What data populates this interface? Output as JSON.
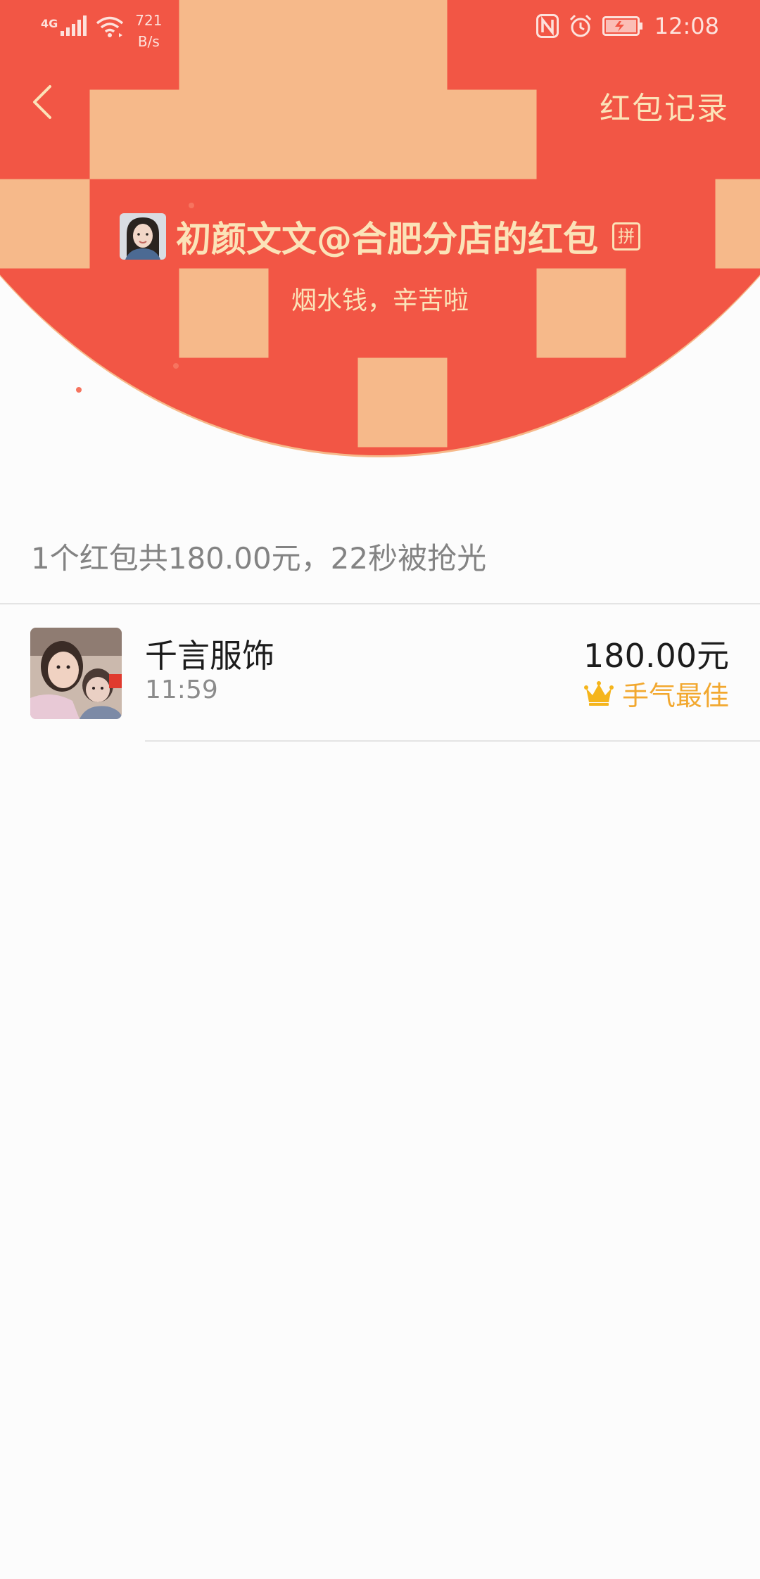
{
  "status_bar": {
    "network": "4G",
    "speed_value": "721",
    "speed_unit": "B/s",
    "time": "12:08",
    "icons": [
      "signal-icon",
      "wifi-icon",
      "nfc-icon",
      "alarm-icon",
      "battery-charging-icon"
    ]
  },
  "nav": {
    "back_icon": "back-arrow-icon",
    "records_label": "红包记录"
  },
  "packet": {
    "sender_title": "初颜文文@合肥分店的红包",
    "badge": "拼",
    "blessing": "烟水钱，辛苦啦"
  },
  "summary": {
    "text": "1个红包共180.00元，22秒被抢光"
  },
  "records": [
    {
      "name": "千言服饰",
      "time": "11:59",
      "amount": "180.00元",
      "best_label": "手气最佳",
      "best_icon": "crown-icon"
    }
  ],
  "colors": {
    "header_red": "#f25645",
    "gold_text": "#fbe3b8",
    "best_orange": "#f2a82f"
  }
}
